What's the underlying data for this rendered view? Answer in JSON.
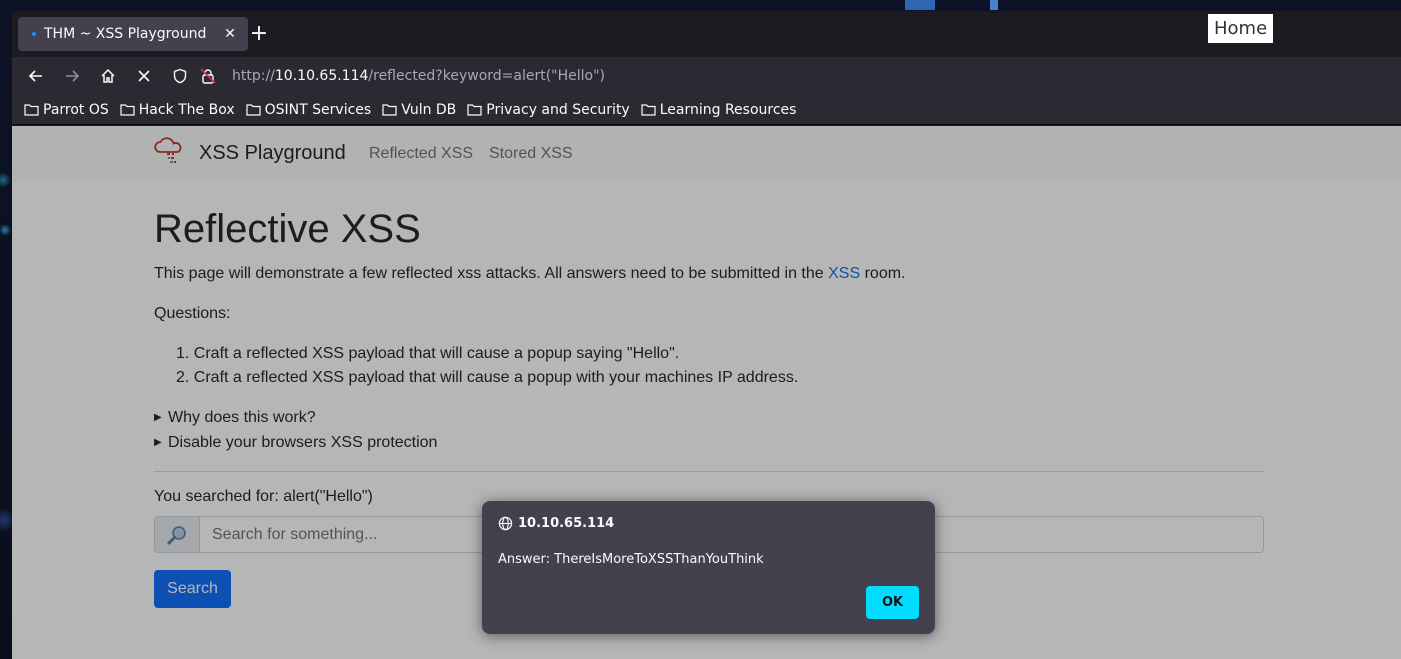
{
  "desktop": {
    "home_label": "Home"
  },
  "browser": {
    "tab": {
      "title": "THM ~ XSS Playground",
      "close": "✕"
    },
    "new_tab": "+",
    "url": {
      "scheme": "http://",
      "host": "10.10.65.114",
      "path": "/reflected?keyword=alert(\"Hello\")"
    },
    "bookmarks": [
      {
        "label": "Parrot OS"
      },
      {
        "label": "Hack The Box"
      },
      {
        "label": "OSINT Services"
      },
      {
        "label": "Vuln DB"
      },
      {
        "label": "Privacy and Security"
      },
      {
        "label": "Learning Resources"
      }
    ]
  },
  "site": {
    "brand": "XSS Playground",
    "nav": [
      "Reflected XSS",
      "Stored XSS"
    ]
  },
  "main": {
    "heading": "Reflective XSS",
    "intro_before": "This page will demonstrate a few reflected xss attacks. All answers need to be submitted in the ",
    "intro_link": "XSS",
    "intro_after": " room.",
    "questions_label": "Questions:",
    "questions": [
      "1. Craft a reflected XSS payload that will cause a popup saying \"Hello\".",
      "2. Craft a reflected XSS payload that will cause a popup with your machines IP address."
    ],
    "details": [
      "Why does this work?",
      "Disable your browsers XSS protection"
    ],
    "searched_for": "You searched for: alert(\"Hello\")",
    "search_placeholder": "Search for something...",
    "search_button": "Search"
  },
  "dialog": {
    "origin": "10.10.65.114",
    "message": "Answer: ThereIsMoreToXSSThanYouThink",
    "ok": "OK"
  },
  "colors": {
    "accent": "#0d6efd",
    "dialog_button": "#00ddff",
    "dialog_bg": "#42414d"
  }
}
